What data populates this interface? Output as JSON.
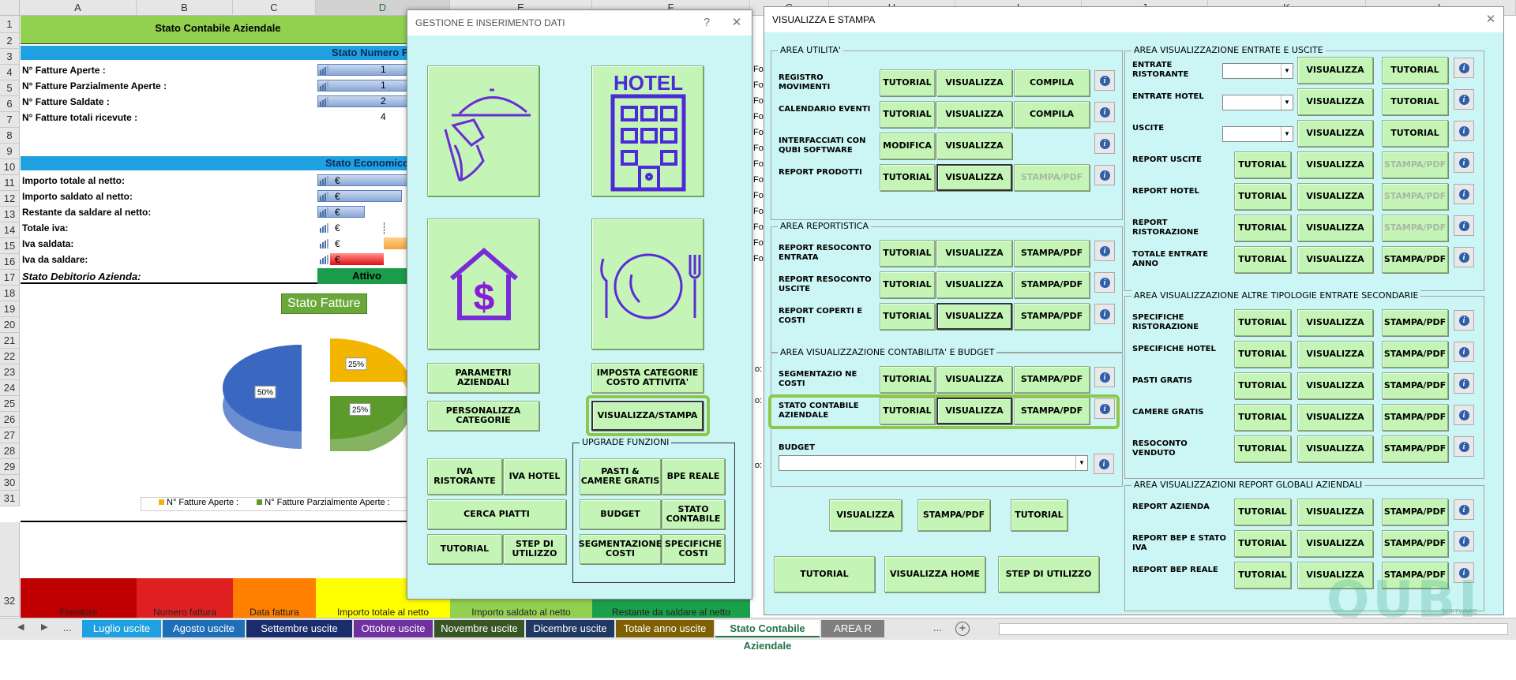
{
  "excel": {
    "columns": [
      "A",
      "B",
      "C",
      "D",
      "E",
      "F",
      "G",
      "H",
      "I",
      "J",
      "K",
      "L"
    ],
    "rows": [
      "1",
      "2",
      "3",
      "4",
      "5",
      "6",
      "7",
      "8",
      "9",
      "10",
      "11",
      "12",
      "13",
      "14",
      "15",
      "16",
      "17",
      "18",
      "19",
      "20",
      "21",
      "22",
      "23",
      "24",
      "25",
      "26",
      "27",
      "28",
      "29",
      "30",
      "31",
      "32"
    ],
    "sheet_title": "Stato Contabile Aziendale",
    "section_numero": "Stato Numero F",
    "section_economico": "Stato  Economico",
    "labels": [
      "N° Fatture Aperte :",
      "N° Fatture Parzialmente Aperte :",
      "N° Fatture Saldate :",
      "N° Fatture totali ricevute :"
    ],
    "values": [
      "1",
      "1",
      "2",
      "4"
    ],
    "eco_labels": [
      "Importo totale al netto:",
      "Importo saldato al netto:",
      "Restante da saldare al netto:",
      "Totale iva:",
      "Iva saldata:",
      "Iva da saldare:"
    ],
    "euro": "€",
    "debitorio": "Stato Debitorio Azienda:",
    "attivo": "Attivo",
    "chart_title": "Stato Fatture",
    "legend": [
      "N° Fatture Aperte :",
      "N° Fatture Parzialmente Aperte :"
    ],
    "footer_headers": [
      "Fornitore",
      "Numero fattura",
      "Data fattura",
      "Importo totale al netto",
      "Importo saldato al netto",
      "Restante da saldare al netto"
    ],
    "right_cells": [
      "For",
      "For",
      "For",
      "For",
      "For",
      "For",
      "For",
      "For",
      "For",
      "For",
      "For",
      "For",
      "For"
    ],
    "right_cells2": [
      "o:",
      "o:",
      "o:"
    ]
  },
  "chart_data": {
    "type": "pie",
    "title": "Stato Fatture",
    "categories": [
      "N° Fatture Aperte :",
      "N° Fatture Parzialmente Aperte :",
      "N° Fatture Saldate :"
    ],
    "values": [
      25,
      25,
      50
    ],
    "labels": [
      "25%",
      "25%",
      "50%"
    ],
    "colors": [
      "#f2b600",
      "#5c9a2c",
      "#3a68c0"
    ]
  },
  "dialog1": {
    "title": "GESTIONE E INSERIMENTO DATI",
    "help": "?",
    "close": "✕",
    "buttons": {
      "parametri": "PARAMETRI AZIENDALI",
      "imposta": "IMPOSTA CATEGORIE COSTO ATTIVITA'",
      "personalizza": "PERSONALIZZA CATEGORIE",
      "visualizza_stampa": "VISUALIZZA/STAMPA",
      "iva_ristorante": "IVA RISTORANTE",
      "iva_hotel": "IVA HOTEL",
      "cerca_piatti": "CERCA PIATTI",
      "tutorial": "TUTORIAL",
      "step": "STEP DI UTILIZZO"
    },
    "upgrade": {
      "title": "UPGRADE FUNZIONI",
      "pasti": "PASTI & CAMERE GRATIS",
      "bpe": "BPE REALE",
      "budget": "BUDGET",
      "stato": "STATO CONTABILE",
      "segmentazione": "SEGMENTAZIONE COSTI",
      "specifiche": "SPECIFICHE COSTI"
    }
  },
  "dialog2": {
    "title": "VISUALIZZA E STAMPA",
    "close": "✕",
    "common": {
      "tutorial": "TUTORIAL",
      "visualizza": "VISUALIZZA",
      "compila": "COMPILA",
      "modifica": "MODIFICA",
      "stampa": "STAMPA/PDF",
      "info": "i"
    },
    "area_utilita": {
      "title": "AREA UTILITA'",
      "rows": [
        "REGISTRO MOVIMENTI",
        "CALENDARIO EVENTI",
        "INTERFACCIATI CON QUBI SOFTWARE",
        "REPORT PRODOTTI"
      ]
    },
    "area_report": {
      "title": "AREA REPORTISTICA",
      "rows": [
        "REPORT RESOCONTO ENTRATA",
        "REPORT RESOCONTO USCITE",
        "REPORT COPERTI E COSTI"
      ]
    },
    "area_contab": {
      "title": "AREA VISUALIZZAZIONE CONTABILITA' E BUDGET",
      "rows": [
        "SEGMENTAZIO NE COSTI",
        "STATO CONTABILE AZIENDALE"
      ],
      "budget": "BUDGET"
    },
    "bottom": {
      "visualizza": "VISUALIZZA",
      "stampa": "STAMPA/PDF",
      "tutorial": "TUTORIAL"
    },
    "footer": {
      "tutorial": "TUTORIAL",
      "home": "VISUALIZZA HOME",
      "step": "STEP DI UTILIZZO"
    },
    "area_entrate": {
      "title": "AREA VISUALIZZAZIONE ENTRATE E USCITE",
      "rows": [
        "ENTRATE RISTORANTE",
        "ENTRATE HOTEL",
        "USCITE",
        "REPORT USCITE",
        "REPORT HOTEL",
        "REPORT RISTORAZIONE",
        "TOTALE ENTRATE ANNO"
      ]
    },
    "area_altre": {
      "title": "AREA VISUALIZZAZIONE ALTRE TIPOLOGIE ENTRATE SECONDARIE",
      "rows": [
        "SPECIFICHE RISTORAZIONE",
        "SPECIFICHE HOTEL",
        "PASTI GRATIS",
        "CAMERE GRATIS",
        "RESOCONTO VENDUTO"
      ]
    },
    "area_globali": {
      "title": "AREA VISUALIZZAZIONI REPORT GLOBALI AZIENDALI",
      "rows": [
        "REPORT AZIENDA",
        "REPORT BEP E STATO IVA",
        "REPORT BEP REALE"
      ]
    },
    "watermark": "QUBI",
    "watermark_sub": "SOFTWARE"
  },
  "tabs": {
    "nav": [
      "◀",
      "▶",
      "..."
    ],
    "sheets": [
      {
        "label": "Luglio uscite",
        "color": "#1fa0e0"
      },
      {
        "label": "Agosto uscite",
        "color": "#1f6fb8"
      },
      {
        "label": "Settembre uscite",
        "color": "#1a2c6b"
      },
      {
        "label": "Ottobre uscite",
        "color": "#7030a0"
      },
      {
        "label": "Novembre uscite",
        "color": "#375623"
      },
      {
        "label": "Dicembre uscite",
        "color": "#1f3864"
      },
      {
        "label": "Totale anno uscite",
        "color": "#7f6000"
      },
      {
        "label": "Stato Contabile Aziendale",
        "color": "#ffffff"
      },
      {
        "label": "AREA R",
        "color": "#7f7f7f"
      }
    ],
    "more": "...",
    "add": "+"
  }
}
